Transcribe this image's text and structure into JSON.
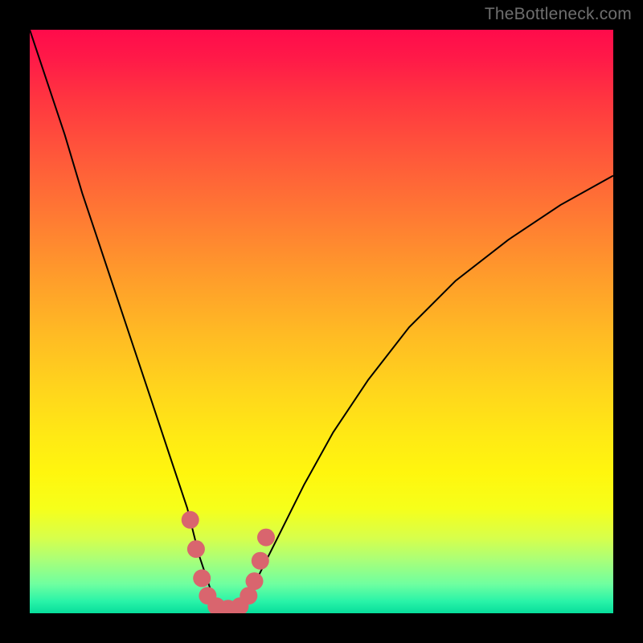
{
  "watermark": "TheBottleneck.com",
  "colors": {
    "curve": "#000000",
    "marker": "#d9656e",
    "frame_bg": "#000000"
  },
  "chart_data": {
    "type": "line",
    "title": "",
    "xlabel": "",
    "ylabel": "",
    "xlim": [
      0,
      100
    ],
    "ylim": [
      0,
      100
    ],
    "series": [
      {
        "name": "bottleneck-curve",
        "x": [
          0,
          3,
          6,
          9,
          12,
          15,
          18,
          21,
          24,
          27,
          29,
          30,
          31,
          32,
          33,
          34,
          35,
          36,
          37,
          38,
          40,
          43,
          47,
          52,
          58,
          65,
          73,
          82,
          91,
          100
        ],
        "y": [
          100,
          91,
          82,
          72,
          63,
          54,
          45,
          36,
          27,
          18,
          10,
          7,
          4,
          2,
          1,
          0.5,
          0.5,
          1,
          2,
          4,
          8,
          14,
          22,
          31,
          40,
          49,
          57,
          64,
          70,
          75
        ]
      }
    ],
    "markers": {
      "name": "highlight-points",
      "color": "#d9656e",
      "points": [
        {
          "x": 27.5,
          "y": 16
        },
        {
          "x": 28.5,
          "y": 11
        },
        {
          "x": 29.5,
          "y": 6
        },
        {
          "x": 30.5,
          "y": 3
        },
        {
          "x": 32,
          "y": 1.2
        },
        {
          "x": 34,
          "y": 0.8
        },
        {
          "x": 36,
          "y": 1.2
        },
        {
          "x": 37.5,
          "y": 3
        },
        {
          "x": 38.5,
          "y": 5.5
        },
        {
          "x": 39.5,
          "y": 9
        },
        {
          "x": 40.5,
          "y": 13
        }
      ]
    }
  }
}
